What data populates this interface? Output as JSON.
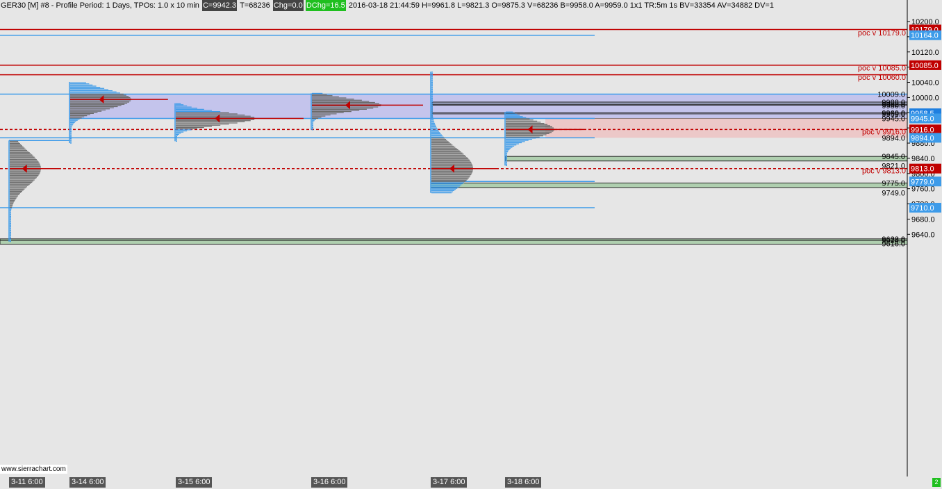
{
  "header": {
    "symbol": "GER30 [M]  #8 - Profile Period: 1 Days, TPOs: 1.0 x 10 min",
    "close": "C=9942.3",
    "ticks": "T=68236",
    "chg": "Chg=0.0",
    "dchg": "DChg=16.5",
    "rest": "2016-03-18 21:44:59 H=9961.8 L=9821.3 O=9875.3 V=68236 B=9958.0 A=9959.0 1x1 TR:5m 1s BV=33354 AV=34882 DV=1"
  },
  "watermark": "www.sierrachart.com",
  "colors": {
    "background": "#e6e6e6",
    "red": "#c00000",
    "blue": "#3d9be9",
    "value_area": "#c4c4ec",
    "red_zone": "#ecc8c8",
    "green_zone": "#afcfaf"
  },
  "price_axis": {
    "ticks": [
      "10200.0",
      "10160.0",
      "10120.0",
      "10080.0",
      "10040.0",
      "10000.0",
      "9960.0",
      "9920.0",
      "9880.0",
      "9840.0",
      "9800.0",
      "9760.0",
      "9720.0",
      "9680.0",
      "9640.0"
    ],
    "min": 9612,
    "max": 10222
  },
  "date_labels": [
    "3-11  6:00",
    "3-14  6:00",
    "3-15  6:00",
    "3-16  6:00",
    "3-17  6:00",
    "3-18  6:00"
  ],
  "price_badges": [
    {
      "text": "10179.0",
      "price": 10179,
      "bg": "#c00000"
    },
    {
      "text": "10164.0",
      "price": 10164,
      "bg": "#3d9be9"
    },
    {
      "text": "10085.0",
      "price": 10085,
      "bg": "#c00000"
    },
    {
      "text": "9958.5",
      "price": 9958.5,
      "bg": "#1e7fe0"
    },
    {
      "text": "9945.0",
      "price": 9945,
      "bg": "#3d9be9"
    },
    {
      "text": "9916.0",
      "price": 9916,
      "bg": "#c00000"
    },
    {
      "text": "9894.0",
      "price": 9894,
      "bg": "#3d9be9"
    },
    {
      "text": "9813.0",
      "price": 9813,
      "bg": "#c00000"
    },
    {
      "text": "9779.0",
      "price": 9779,
      "bg": "#3d9be9"
    },
    {
      "text": "9710.0",
      "price": 9710,
      "bg": "#3d9be9"
    }
  ],
  "level_labels": [
    {
      "text": "10009.0",
      "price": 10009
    },
    {
      "text": "9988.0",
      "price": 9988
    },
    {
      "text": "9982.0",
      "price": 9982
    },
    {
      "text": "9980.0",
      "price": 9979
    },
    {
      "text": "9960.0",
      "price": 9960
    },
    {
      "text": "9959.0",
      "price": 9957
    },
    {
      "text": "9945.0",
      "price": 9945
    },
    {
      "text": "9894.0",
      "price": 9894
    },
    {
      "text": "9845.0",
      "price": 9845
    },
    {
      "text": "9821.0",
      "price": 9821
    },
    {
      "text": "9775.0",
      "price": 9775
    },
    {
      "text": "9749.0",
      "price": 9749
    },
    {
      "text": "9628.0",
      "price": 9628
    },
    {
      "text": "9624.0",
      "price": 9624
    },
    {
      "text": "9616.0",
      "price": 9616
    }
  ],
  "poc_labels": [
    {
      "text": "poc v  10179.0",
      "price": 10171
    },
    {
      "text": "poc v  10085.0",
      "price": 10078
    },
    {
      "text": "poc v  10060.0",
      "price": 10054
    },
    {
      "text": "poc v  9916.0",
      "price": 9910
    },
    {
      "text": "poc v  9813.0",
      "price": 9808
    }
  ],
  "profiles": [
    {
      "day": "3-11",
      "low": 9621,
      "high": 9887,
      "poc": 9813,
      "val": 9710,
      "vah": 9887
    },
    {
      "day": "3-14",
      "low": 9880,
      "high": 10041,
      "poc": 9995,
      "val": 9945,
      "vah": 10009
    },
    {
      "day": "3-15",
      "low": 9885,
      "high": 9985,
      "poc": 9945,
      "val": 9916,
      "vah": 9960
    },
    {
      "day": "3-16",
      "low": 9915,
      "high": 10011,
      "poc": 9980,
      "val": 9945,
      "vah": 10009
    },
    {
      "day": "3-17",
      "low": 9749,
      "high": 10068,
      "poc": 9813,
      "val": 9779,
      "vah": 9894
    },
    {
      "day": "3-18",
      "low": 9821,
      "high": 9962,
      "poc": 9916,
      "val": 9894,
      "vah": 9945
    }
  ]
}
